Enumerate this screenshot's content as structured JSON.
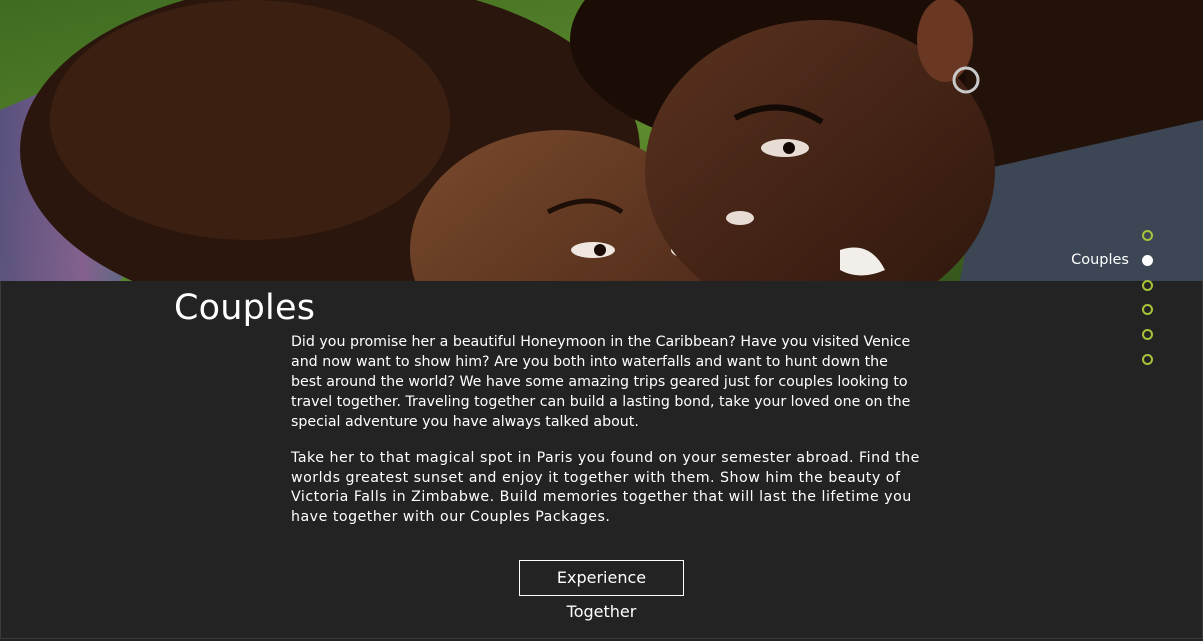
{
  "section": {
    "title": "Couples",
    "paragraphs": [
      "Did you promise her a beautiful Honeymoon in the Caribbean? Have you visited Venice and now want to show him? Are you both into waterfalls and want to hunt down the best around the world? We have some amazing trips geared just for couples looking to travel together. Traveling together can build a lasting bond, take your loved one on the special adventure you have always talked about.",
      "Take her to that magical spot in Paris you found on your semester abroad. Find the worlds greatest sunset and enjoy it together with them. Show him the beauty of Victoria Falls in Zimbabwe. Build memories together that will last the lifetime you have together with our Couples Packages."
    ],
    "cta_label": "Experience Together"
  },
  "section_nav": {
    "active_label": "Couples",
    "active_index": 1,
    "dot_count": 6,
    "colors": {
      "inactive_ring": "#a6c33a",
      "active_fill": "#ffffff"
    }
  },
  "theme": {
    "panel_background": "#232323",
    "text_color": "#ffffff"
  }
}
